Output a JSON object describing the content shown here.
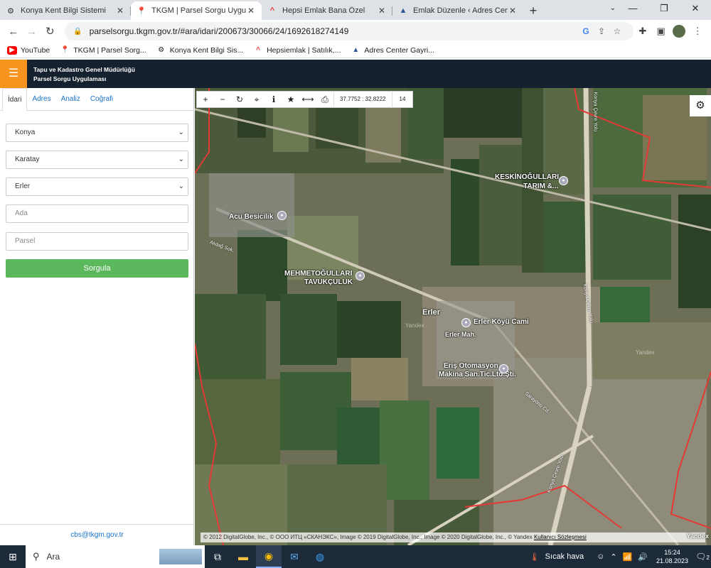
{
  "browser": {
    "tabs": [
      {
        "title": "Konya Kent Bilgi Sistemi",
        "icon": "globe-icon",
        "active": false
      },
      {
        "title": "TKGM | Parsel Sorgu Uygulaması",
        "icon": "map-pin-icon",
        "active": true
      },
      {
        "title": "Hepsi Emlak Bana Özel",
        "icon": "hepsiemlak-icon",
        "active": false
      },
      {
        "title": "Emlak Düzenle ‹ Adres Center Ga",
        "icon": "adres-center-icon",
        "active": false
      }
    ],
    "url": "parselsorgu.tkgm.gov.tr/#ara/idari/200673/30066/24/1692618274149",
    "bookmarks": [
      {
        "label": "YouTube",
        "icon": "youtube-icon"
      },
      {
        "label": "TKGM | Parsel Sorg...",
        "icon": "map-pin-icon"
      },
      {
        "label": "Konya Kent Bilgi Sis...",
        "icon": "globe-icon"
      },
      {
        "label": "Hepsiemlak | Satılık,...",
        "icon": "hepsiemlak-icon"
      },
      {
        "label": "Adres Center Gayri...",
        "icon": "adres-center-icon"
      }
    ]
  },
  "app": {
    "title_line1": "Tapu ve Kadastro Genel Müdürlüğü",
    "title_line2": "Parsel Sorgu Uygulaması",
    "accent": "#f7941d",
    "header_bg": "#162130"
  },
  "sidebar": {
    "tabs": [
      "İdari",
      "Adres",
      "Analiz",
      "Coğrafi"
    ],
    "il": "Konya",
    "ilce": "Karatay",
    "mahalle": "Erler",
    "ada_placeholder": "Ada",
    "parsel_placeholder": "Parsel",
    "submit_label": "Sorgula",
    "footer_email": "cbs@tkgm.gov.tr",
    "submit_color": "#5cb85c"
  },
  "map": {
    "coords": "37.7752 : 32.8222",
    "zoom": "14",
    "labels": {
      "keskin1": "KESKİNOĞULLARI",
      "keskin2": "TARIM &...",
      "acu": "Acu Besicilik",
      "mehmet1": "MEHMETOĞULLARI",
      "mehmet2": "TAVUKÇULUK",
      "erler": "Erler",
      "cami": "Erler Köyü Cami",
      "erlerman": "Erler Mah.",
      "eris1": "Eriş Otomasyon",
      "eris2": "Makina San.Tic.Ltd.Şti."
    },
    "roads": {
      "konya1": "Konya Çevre Yolu",
      "konya2": "Konya Çevre Yolu",
      "konya3": "Konya Çevre Yolu",
      "sokak": "Akdağ Sok.",
      "sarayonu": "Sarayönü Cd."
    },
    "watermark": "Yandex",
    "attribution": "© 2012 DigitalGlobe, Inc., © ООО ИТЦ «СКАНЭКС», Image © 2019 DigitalGlobe, Inc., Image © 2020 DigitalGlobe, Inc., © Yandex",
    "terms_link": "Kullanıcı Sözleşmesi",
    "brand": "Yandex"
  },
  "taskbar": {
    "search_placeholder": "Ara",
    "weather": "Sıcak hava",
    "time": "15:24",
    "date": "21.08.2023",
    "notif_count": "2"
  }
}
